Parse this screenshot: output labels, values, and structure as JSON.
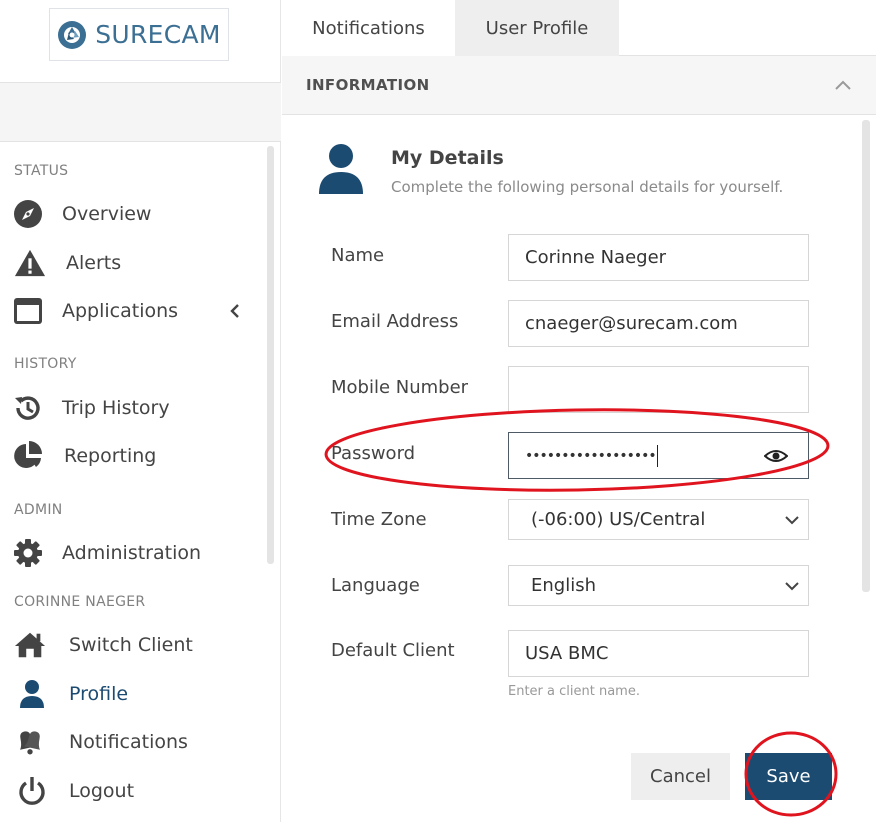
{
  "brand": {
    "name": "SURECAM"
  },
  "sidebar": {
    "sections": [
      {
        "label": "STATUS"
      },
      {
        "label": "HISTORY"
      },
      {
        "label": "ADMIN"
      },
      {
        "label": "CORINNE NAEGER"
      }
    ],
    "items": [
      {
        "label": "Overview",
        "icon": "compass-icon"
      },
      {
        "label": "Alerts",
        "icon": "warning-icon"
      },
      {
        "label": "Applications",
        "icon": "window-icon"
      },
      {
        "label": "Trip History",
        "icon": "history-icon"
      },
      {
        "label": "Reporting",
        "icon": "pie-chart-icon"
      },
      {
        "label": "Administration",
        "icon": "gear-icon"
      },
      {
        "label": "Switch Client",
        "icon": "home-icon"
      },
      {
        "label": "Profile",
        "icon": "user-icon",
        "active": true
      },
      {
        "label": "Notifications",
        "icon": "bells-icon"
      },
      {
        "label": "Logout",
        "icon": "power-icon"
      }
    ]
  },
  "tabs": [
    {
      "label": "Notifications",
      "active": false
    },
    {
      "label": "User Profile",
      "active": true
    }
  ],
  "section": {
    "title": "INFORMATION"
  },
  "details": {
    "title": "My Details",
    "subtitle": "Complete the following personal details for yourself."
  },
  "form": {
    "name": {
      "label": "Name",
      "value": "Corinne Naeger"
    },
    "email": {
      "label": "Email Address",
      "value": "cnaeger@surecam.com"
    },
    "mobile": {
      "label": "Mobile Number",
      "value": ""
    },
    "password": {
      "label": "Password",
      "masked": "••••••••••••••••••"
    },
    "timezone": {
      "label": "Time Zone",
      "value": "(-06:00) US/Central"
    },
    "language": {
      "label": "Language",
      "value": "English"
    },
    "client": {
      "label": "Default Client",
      "value": "USA BMC",
      "help": "Enter a client name."
    }
  },
  "buttons": {
    "cancel": "Cancel",
    "save": "Save"
  },
  "colors": {
    "accent": "#1c4b72",
    "annotation": "#e0141e",
    "logo": "#3b6f93"
  }
}
